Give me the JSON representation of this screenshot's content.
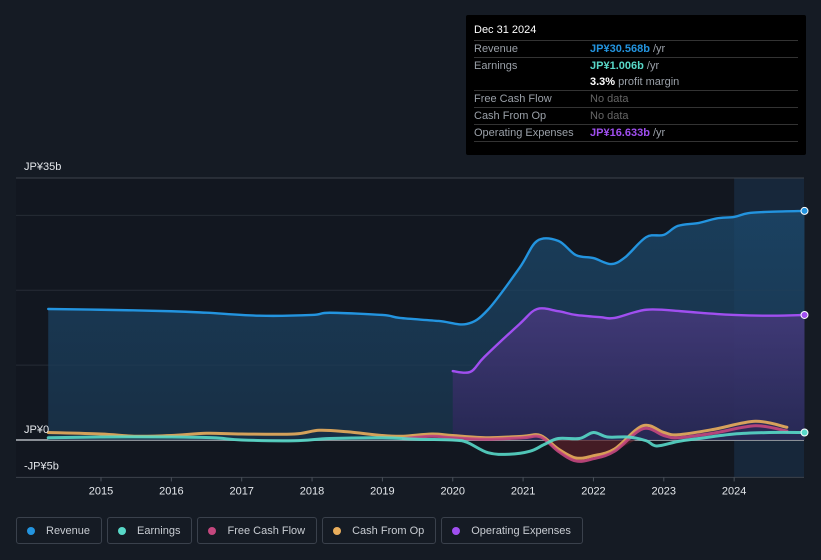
{
  "tooltip": {
    "date": "Dec 31 2024",
    "rows": [
      {
        "key": "Revenue",
        "value": "JP¥30.568b",
        "suffix": " /yr",
        "color": "#2394df"
      },
      {
        "key": "Earnings",
        "value": "JP¥1.006b",
        "suffix": " /yr",
        "color": "#58d8c8"
      },
      {
        "key": "",
        "value": "3.3%",
        "suffix": " profit margin",
        "color": "#ffffff"
      },
      {
        "key": "Free Cash Flow",
        "value": "",
        "suffix": "No data",
        "color": "#777777"
      },
      {
        "key": "Cash From Op",
        "value": "",
        "suffix": "No data",
        "color": "#777777"
      },
      {
        "key": "Operating Expenses",
        "value": "JP¥16.633b",
        "suffix": " /yr",
        "color": "#a04ff0"
      }
    ]
  },
  "legend": [
    {
      "label": "Revenue",
      "color": "#2394df"
    },
    {
      "label": "Earnings",
      "color": "#58d8c8"
    },
    {
      "label": "Free Cash Flow",
      "color": "#c4477e"
    },
    {
      "label": "Cash From Op",
      "color": "#e9ae5c"
    },
    {
      "label": "Operating Expenses",
      "color": "#a04ff0"
    }
  ],
  "chart_data": {
    "type": "area",
    "title": "",
    "xlabel": "",
    "ylabel": "",
    "ylim": [
      -5,
      35
    ],
    "xlim": [
      2014.25,
      2025.0
    ],
    "y_tick_labels": [
      {
        "value": 35,
        "label": "JP¥35b"
      },
      {
        "value": 0,
        "label": "JP¥0"
      },
      {
        "value": -5,
        "label": "-JP¥5b"
      }
    ],
    "gridlines": [
      35,
      30,
      20,
      10,
      0,
      -5
    ],
    "x_ticks": [
      2015,
      2016,
      2017,
      2018,
      2019,
      2020,
      2021,
      2022,
      2023,
      2024
    ],
    "highlight_start": 2024.0,
    "grid": true,
    "legend_position": "bottom-left",
    "series": [
      {
        "name": "Revenue",
        "color": "#2394df",
        "fill": true,
        "points": [
          [
            2014.25,
            17.5
          ],
          [
            2015.0,
            17.4
          ],
          [
            2016.0,
            17.2
          ],
          [
            2016.5,
            17.0
          ],
          [
            2017.25,
            16.6
          ],
          [
            2018.0,
            16.7
          ],
          [
            2018.25,
            17.0
          ],
          [
            2019.0,
            16.7
          ],
          [
            2019.25,
            16.3
          ],
          [
            2019.8,
            15.9
          ],
          [
            2020.2,
            15.5
          ],
          [
            2020.5,
            17.4
          ],
          [
            2020.95,
            23.0
          ],
          [
            2021.2,
            26.6
          ],
          [
            2021.5,
            26.6
          ],
          [
            2021.75,
            24.7
          ],
          [
            2022.0,
            24.3
          ],
          [
            2022.25,
            23.5
          ],
          [
            2022.45,
            24.4
          ],
          [
            2022.75,
            27.1
          ],
          [
            2023.0,
            27.4
          ],
          [
            2023.2,
            28.6
          ],
          [
            2023.5,
            29.0
          ],
          [
            2023.75,
            29.6
          ],
          [
            2024.0,
            29.8
          ],
          [
            2024.2,
            30.3
          ],
          [
            2024.55,
            30.5
          ],
          [
            2025.0,
            30.6
          ]
        ]
      },
      {
        "name": "Operating Expenses",
        "color": "#a04ff0",
        "fill": true,
        "points": [
          [
            2020.0,
            9.2
          ],
          [
            2020.25,
            9.1
          ],
          [
            2020.45,
            11.1
          ],
          [
            2020.95,
            15.5
          ],
          [
            2021.2,
            17.5
          ],
          [
            2021.5,
            17.2
          ],
          [
            2021.75,
            16.7
          ],
          [
            2022.1,
            16.4
          ],
          [
            2022.3,
            16.3
          ],
          [
            2022.75,
            17.4
          ],
          [
            2023.25,
            17.2
          ],
          [
            2023.5,
            17.0
          ],
          [
            2024.0,
            16.7
          ],
          [
            2024.5,
            16.6
          ],
          [
            2025.0,
            16.7
          ]
        ]
      },
      {
        "name": "Cash From Op",
        "color": "#e9ae5c",
        "fill": false,
        "points": [
          [
            2014.25,
            1.0
          ],
          [
            2015.0,
            0.8
          ],
          [
            2015.5,
            0.5
          ],
          [
            2016.0,
            0.6
          ],
          [
            2016.5,
            0.9
          ],
          [
            2017.0,
            0.8
          ],
          [
            2017.75,
            0.8
          ],
          [
            2018.1,
            1.3
          ],
          [
            2018.5,
            1.1
          ],
          [
            2019.0,
            0.6
          ],
          [
            2019.3,
            0.5
          ],
          [
            2019.7,
            0.8
          ],
          [
            2020.0,
            0.6
          ],
          [
            2020.5,
            0.3
          ],
          [
            2021.0,
            0.5
          ],
          [
            2021.25,
            0.6
          ],
          [
            2021.5,
            -1.2
          ],
          [
            2021.75,
            -2.4
          ],
          [
            2022.0,
            -2.1
          ],
          [
            2022.3,
            -1.2
          ],
          [
            2022.7,
            1.9
          ],
          [
            2023.0,
            1.0
          ],
          [
            2023.2,
            0.7
          ],
          [
            2023.7,
            1.4
          ],
          [
            2024.3,
            2.5
          ],
          [
            2024.75,
            1.7
          ]
        ]
      },
      {
        "name": "Free Cash Flow",
        "color": "#c4477e",
        "fill": false,
        "points": [
          [
            2019.3,
            0.2
          ],
          [
            2019.7,
            0.5
          ],
          [
            2020.0,
            0.3
          ],
          [
            2020.5,
            0.1
          ],
          [
            2021.0,
            0.3
          ],
          [
            2021.25,
            0.4
          ],
          [
            2021.5,
            -1.5
          ],
          [
            2021.75,
            -2.8
          ],
          [
            2022.0,
            -2.5
          ],
          [
            2022.3,
            -1.5
          ],
          [
            2022.7,
            1.5
          ],
          [
            2023.0,
            0.6
          ],
          [
            2023.2,
            0.3
          ],
          [
            2023.7,
            0.9
          ],
          [
            2024.3,
            1.9
          ],
          [
            2024.75,
            1.2
          ]
        ]
      },
      {
        "name": "Earnings",
        "color": "#58d8c8",
        "fill": false,
        "points": [
          [
            2014.25,
            0.3
          ],
          [
            2015.0,
            0.4
          ],
          [
            2016.0,
            0.4
          ],
          [
            2016.6,
            0.3
          ],
          [
            2017.0,
            0.0
          ],
          [
            2017.75,
            -0.1
          ],
          [
            2018.25,
            0.2
          ],
          [
            2019.0,
            0.3
          ],
          [
            2019.5,
            0.1
          ],
          [
            2020.0,
            0.0
          ],
          [
            2020.2,
            -0.3
          ],
          [
            2020.5,
            -1.7
          ],
          [
            2020.8,
            -1.9
          ],
          [
            2021.1,
            -1.5
          ],
          [
            2021.3,
            -0.6
          ],
          [
            2021.5,
            0.2
          ],
          [
            2021.8,
            0.2
          ],
          [
            2022.0,
            1.0
          ],
          [
            2022.2,
            0.4
          ],
          [
            2022.5,
            0.4
          ],
          [
            2022.75,
            -0.1
          ],
          [
            2022.9,
            -0.8
          ],
          [
            2023.2,
            -0.2
          ],
          [
            2023.5,
            0.2
          ],
          [
            2024.0,
            0.8
          ],
          [
            2024.5,
            1.0
          ],
          [
            2025.0,
            1.0
          ]
        ]
      }
    ]
  }
}
